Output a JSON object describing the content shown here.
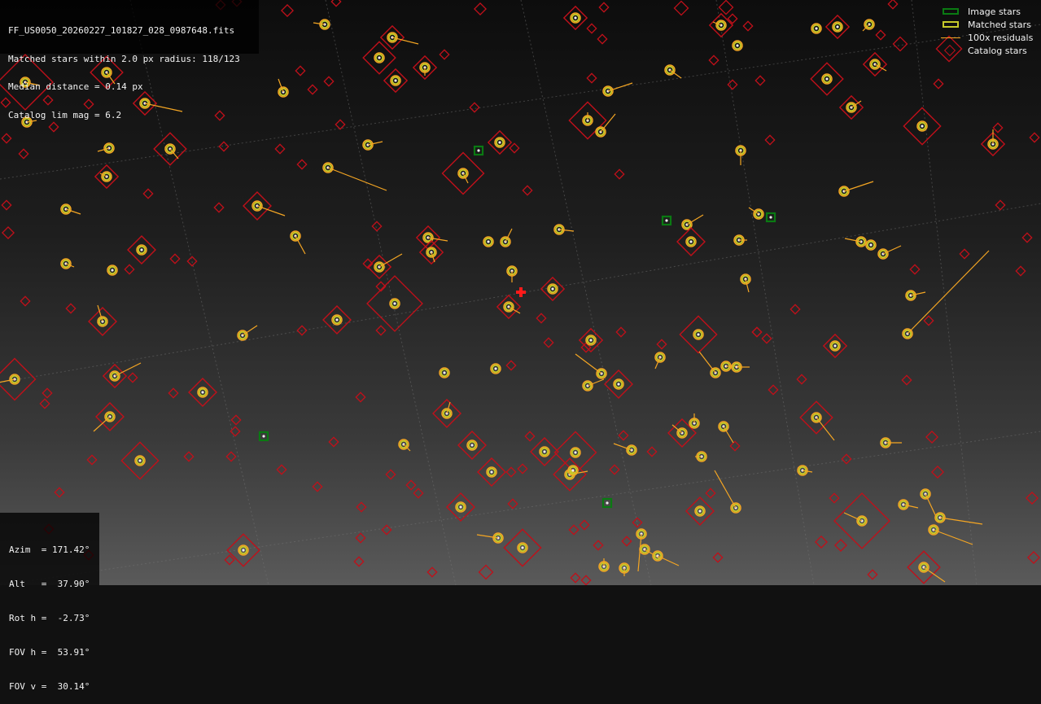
{
  "info": {
    "filename": "FF_US0050_20260227_101827_028_0987648.fits",
    "matched_line": "Matched stars within 2.0 px radius: 118/123",
    "median_line": "Median distance = 0.14 px",
    "catalog_line": "Catalog lim mag = 6.2"
  },
  "pointing": {
    "azim": "Azim  = 171.42°",
    "alt": "Alt   =  37.90°",
    "rot": "Rot h =  -2.73°",
    "fov_h": "FOV h =  53.91°",
    "fov_v": "FOV v =  30.14°"
  },
  "legend": {
    "image_stars": "Image stars",
    "matched_stars": "Matched stars",
    "residuals": "100x residuals",
    "catalog_stars": "Catalog stars"
  },
  "colors": {
    "catalog": "#c0101a",
    "matched": "#c6c92a",
    "residual": "#f5a623",
    "image": "#0a7a12",
    "center": "#ff1a1a"
  }
}
